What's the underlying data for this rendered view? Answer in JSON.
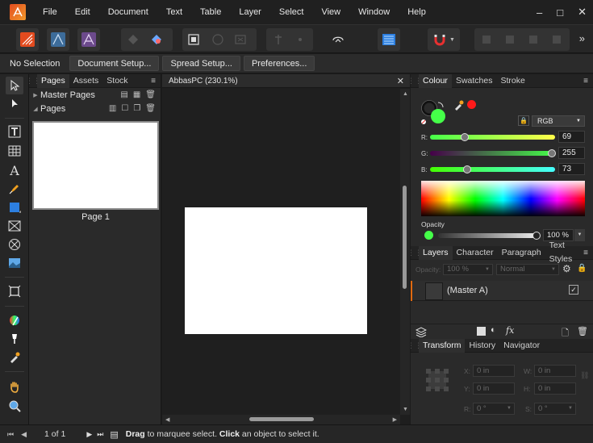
{
  "menu": {
    "items": [
      "File",
      "Edit",
      "Document",
      "Text",
      "Table",
      "Layer",
      "Select",
      "View",
      "Window",
      "Help"
    ],
    "window_controls": {
      "minimize": "–",
      "maximize": "□",
      "close": "✕"
    }
  },
  "toolbar": {
    "overflow": "»"
  },
  "context_bar": {
    "status": "No Selection",
    "buttons": [
      "Document Setup...",
      "Spread Setup...",
      "Preferences..."
    ]
  },
  "tools": [
    "move-tool",
    "node-tool",
    "text-frame-tool",
    "table-tool",
    "artistic-text-tool",
    "pen-tool",
    "rectangle-tool",
    "picture-frame-tool",
    "ellipse-frame-tool",
    "place-image-tool",
    "crop-tool",
    "color-picker-tool",
    "fill-tool",
    "eyedropper-tool",
    "hand-tool",
    "zoom-tool"
  ],
  "pages_panel": {
    "tabs": [
      "Pages",
      "Assets",
      "Stock"
    ],
    "active_tab": "Pages",
    "menu_icon": "≡",
    "rows": {
      "master_pages": "Master Pages",
      "pages": "Pages"
    },
    "page_label": "Page 1"
  },
  "document": {
    "tab_title": "AbbasPC (230.1%)",
    "close": "✕"
  },
  "colour_panel": {
    "tabs": [
      "Colour",
      "Swatches",
      "Stroke"
    ],
    "active_tab": "Colour",
    "model": "RGB",
    "sliders": [
      {
        "label": "R:",
        "value": "69"
      },
      {
        "label": "G:",
        "value": "255"
      },
      {
        "label": "B:",
        "value": "73"
      }
    ],
    "fill_color": "#45ff49",
    "opacity_label": "Opacity",
    "opacity_value": "100 %"
  },
  "layers_panel": {
    "tabs": [
      "Layers",
      "Character",
      "Paragraph",
      "Text Styles"
    ],
    "active_tab": "Layers",
    "opacity_label": "Opacity:",
    "opacity_value": "100 %",
    "blend_mode": "Normal",
    "layer_name": "(Master A)",
    "layer_checked": "✓"
  },
  "transform_panel": {
    "tabs": [
      "Transform",
      "History",
      "Navigator"
    ],
    "active_tab": "Transform",
    "fields": {
      "x": {
        "label": "X:",
        "value": "0 in"
      },
      "y": {
        "label": "Y:",
        "value": "0 in"
      },
      "w": {
        "label": "W:",
        "value": "0 in"
      },
      "h": {
        "label": "H:",
        "value": "0 in"
      },
      "r": {
        "label": "R:",
        "value": "0 °"
      },
      "s": {
        "label": "S:",
        "value": "0 °"
      }
    }
  },
  "statusbar": {
    "page_indicator": "1 of 1",
    "msg_drag": "Drag",
    "msg_1": " to marquee select. ",
    "msg_click": "Click",
    "msg_2": " an object to select it."
  },
  "colors": {
    "accent": "#2d7fe0",
    "brand": "#e24b1f",
    "red_swatch": "#ff1a1a"
  }
}
